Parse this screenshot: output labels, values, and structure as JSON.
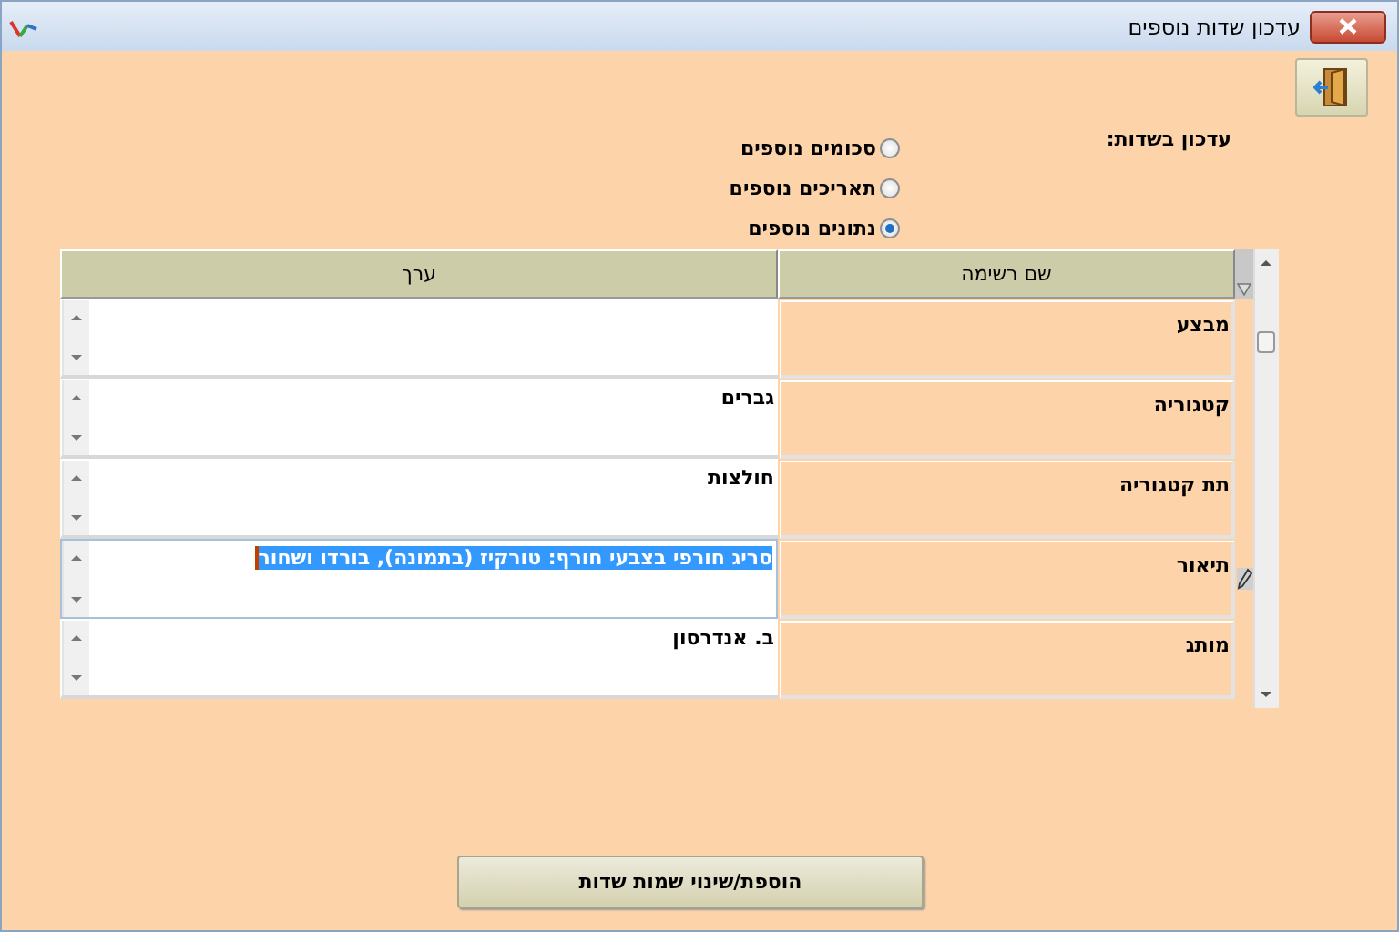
{
  "window": {
    "title": "עדכון שדות נוספים"
  },
  "update_label": "עדכון בשדות:",
  "field_types": [
    {
      "label": "סכומים נוספים",
      "selected": false
    },
    {
      "label": "תאריכים נוספים",
      "selected": false
    },
    {
      "label": "נתונים נוספים",
      "selected": true
    }
  ],
  "table": {
    "columns": [
      "שם רשימה",
      "ערך"
    ],
    "rows": [
      {
        "name": "מבצע",
        "editing": false
      },
      {
        "name": "קטגוריה",
        "value": "גברים",
        "editing": false
      },
      {
        "name": "תת קטגוריה",
        "value": "חולצות",
        "editing": false
      },
      {
        "name": "תיאור",
        "value": "סריג חורפי בצבעי חורף: טורקיז (בתמונה), בורדו ושחור",
        "editing": true
      },
      {
        "name": "מותג",
        "value": "ב. אנדרסון",
        "editing": false
      }
    ]
  },
  "add_button": "הוספת/שינוי שמות שדות"
}
